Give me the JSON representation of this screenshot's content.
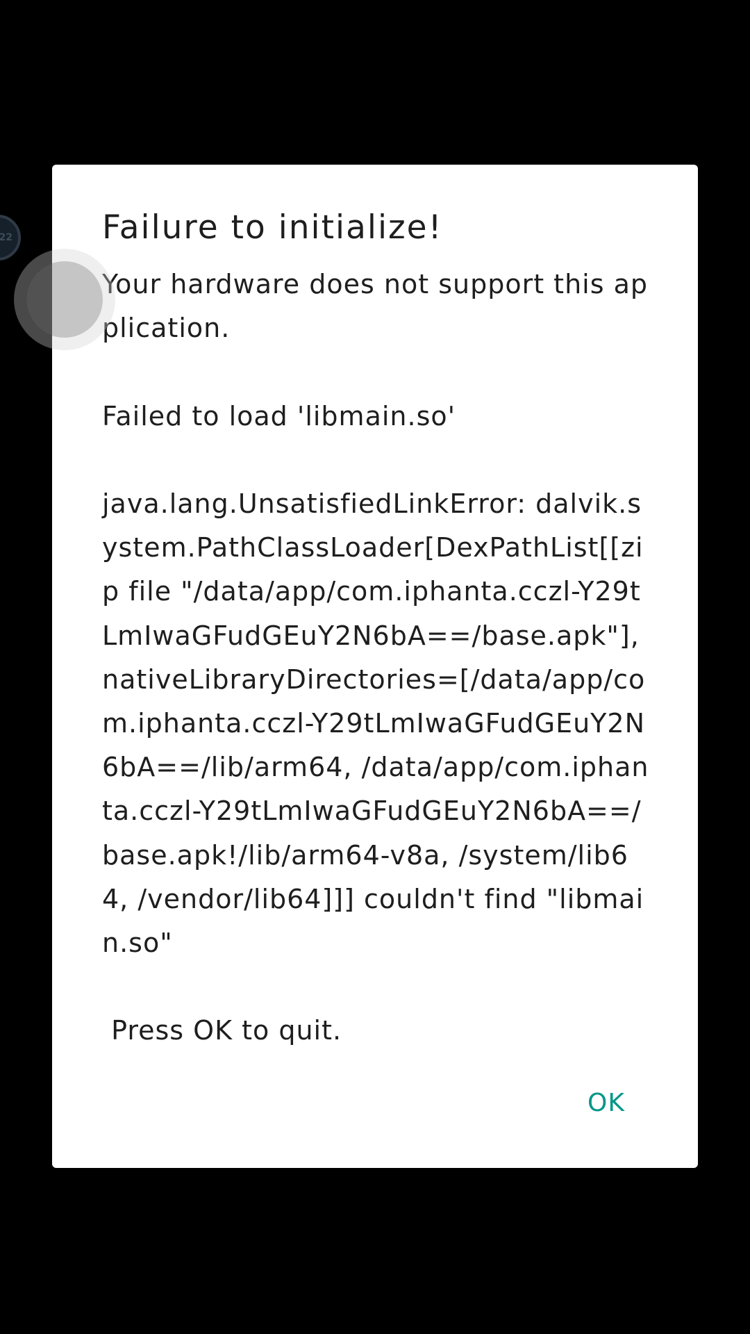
{
  "side_bubble": {
    "text": "22"
  },
  "dialog": {
    "title": "Failure to initialize!",
    "message": "Your hardware does not support this application.\n\nFailed to load 'libmain.so'\n\njava.lang.UnsatisfiedLinkError: dalvik.system.PathClassLoader[DexPathList[[zip file \"/data/app/com.iphanta.cczl-Y29tLmIwaGFudGEuY2N6bA==/base.apk\"],nativeLibraryDirectories=[/data/app/com.iphanta.cczl-Y29tLmIwaGFudGEuY2N6bA==/lib/arm64, /data/app/com.iphanta.cczl-Y29tLmIwaGFudGEuY2N6bA==/base.apk!/lib/arm64-v8a, /system/lib64, /vendor/lib64]]] couldn't find \"libmain.so\"\n\n Press OK to quit.",
    "ok_label": "OK"
  },
  "colors": {
    "background": "#000000",
    "dialog": "#ffffff",
    "text": "#1e1e1e",
    "accent": "#009688"
  }
}
